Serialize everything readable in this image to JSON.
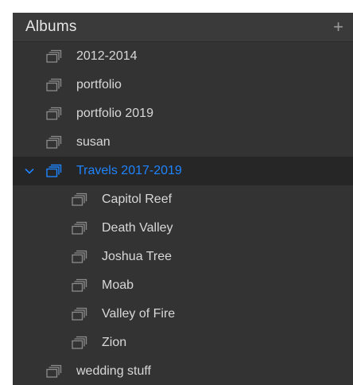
{
  "panel": {
    "title": "Albums",
    "add_label": "+"
  },
  "albums": [
    {
      "label": "2012-2014"
    },
    {
      "label": "portfolio"
    },
    {
      "label": "portfolio 2019"
    },
    {
      "label": "susan"
    },
    {
      "label": "Travels 2017-2019"
    },
    {
      "label": "Capitol Reef"
    },
    {
      "label": "Death Valley"
    },
    {
      "label": "Joshua Tree"
    },
    {
      "label": "Moab"
    },
    {
      "label": "Valley of Fire"
    },
    {
      "label": "Zion"
    },
    {
      "label": "wedding stuff"
    }
  ],
  "colors": {
    "panel_bg": "#333333",
    "selected_bg": "#262626",
    "accent": "#1f84ff",
    "text": "#d8d8d8"
  }
}
